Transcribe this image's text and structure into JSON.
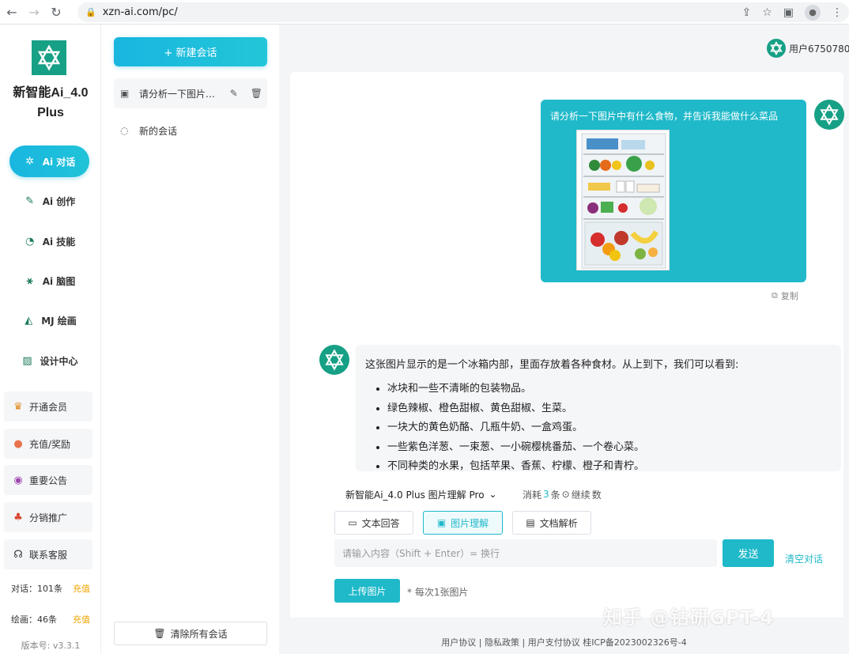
{
  "browser": {
    "url": "xzn-ai.com/pc/"
  },
  "brand": {
    "name_line1": "新智能Ai_4.0",
    "name_line2": "Plus"
  },
  "nav": [
    {
      "label": "Ai 对话",
      "icon": "gear-icon",
      "active": true
    },
    {
      "label": "Ai 创作",
      "icon": "pen-icon",
      "active": false
    },
    {
      "label": "Ai 技能",
      "icon": "skill-icon",
      "active": false
    },
    {
      "label": "Ai 脑图",
      "icon": "mindmap-icon",
      "active": false
    },
    {
      "label": "MJ 绘画",
      "icon": "paint-icon",
      "active": false
    },
    {
      "label": "设计中心",
      "icon": "design-icon",
      "active": false
    }
  ],
  "side_cards": [
    {
      "label": "开通会员",
      "icon": "crown-icon"
    },
    {
      "label": "充值/奖励",
      "icon": "recharge-icon"
    },
    {
      "label": "重要公告",
      "icon": "eye-icon"
    },
    {
      "label": "分销推广",
      "icon": "network-icon"
    },
    {
      "label": "联系客服",
      "icon": "headset-icon"
    }
  ],
  "stats": {
    "dialog_label": "对话：101条",
    "dialog_link": "充值",
    "draw_label": "绘画：46条",
    "draw_link": "充值"
  },
  "version": "版本号: v3.3.1",
  "sessions": {
    "new_chat": "+ 新建会话",
    "items": [
      {
        "title": "请分析一下图片中...",
        "icon": "image-icon",
        "active": true
      },
      {
        "title": "新的会话",
        "icon": "chat-icon",
        "active": false
      }
    ],
    "clear_all": "清除所有会话"
  },
  "header": {
    "user": "用户6750780"
  },
  "chat": {
    "user_message": "请分析一下图片中有什么食物，并告诉我能做什么菜品",
    "copy_label": "复制",
    "answer_intro": "这张图片显示的是一个冰箱内部，里面存放着各种食材。从上到下，我们可以看到:",
    "answer_items": [
      "冰块和一些不清晰的包装物品。",
      "绿色辣椒、橙色甜椒、黄色甜椒、生菜。",
      "一块大的黄色奶酪、几瓶牛奶、一盒鸡蛋。",
      "一些紫色洋葱、一束葱、一小碗樱桃番茄、一个卷心菜。",
      "不同种类的水果，包括苹果、香蕉、柠檬、橙子和青柠。"
    ]
  },
  "composer": {
    "model": "新智能Ai_4.0 Plus 图片理解 Pro",
    "cost_prefix": "消耗",
    "cost_num": "3",
    "cost_suffix": "条",
    "continue_label": "继续",
    "cost_tail": "数",
    "modes": [
      {
        "label": "文本回答",
        "icon": "text-chat-icon",
        "active": false
      },
      {
        "label": "图片理解",
        "icon": "image-icon",
        "active": true
      },
      {
        "label": "文档解析",
        "icon": "document-icon",
        "active": false
      }
    ],
    "placeholder": "请输入内容（Shift + Enter）= 换行",
    "send": "发送",
    "clear_chat": "清空对话",
    "upload": "上传图片",
    "upload_hint": "* 每次1张图片"
  },
  "footer": {
    "text": "用户协议 | 隐私政策 | 用户支付协议    桂ICP备2023002326号-4"
  },
  "watermark": "知乎 @钴研GPT-4"
}
